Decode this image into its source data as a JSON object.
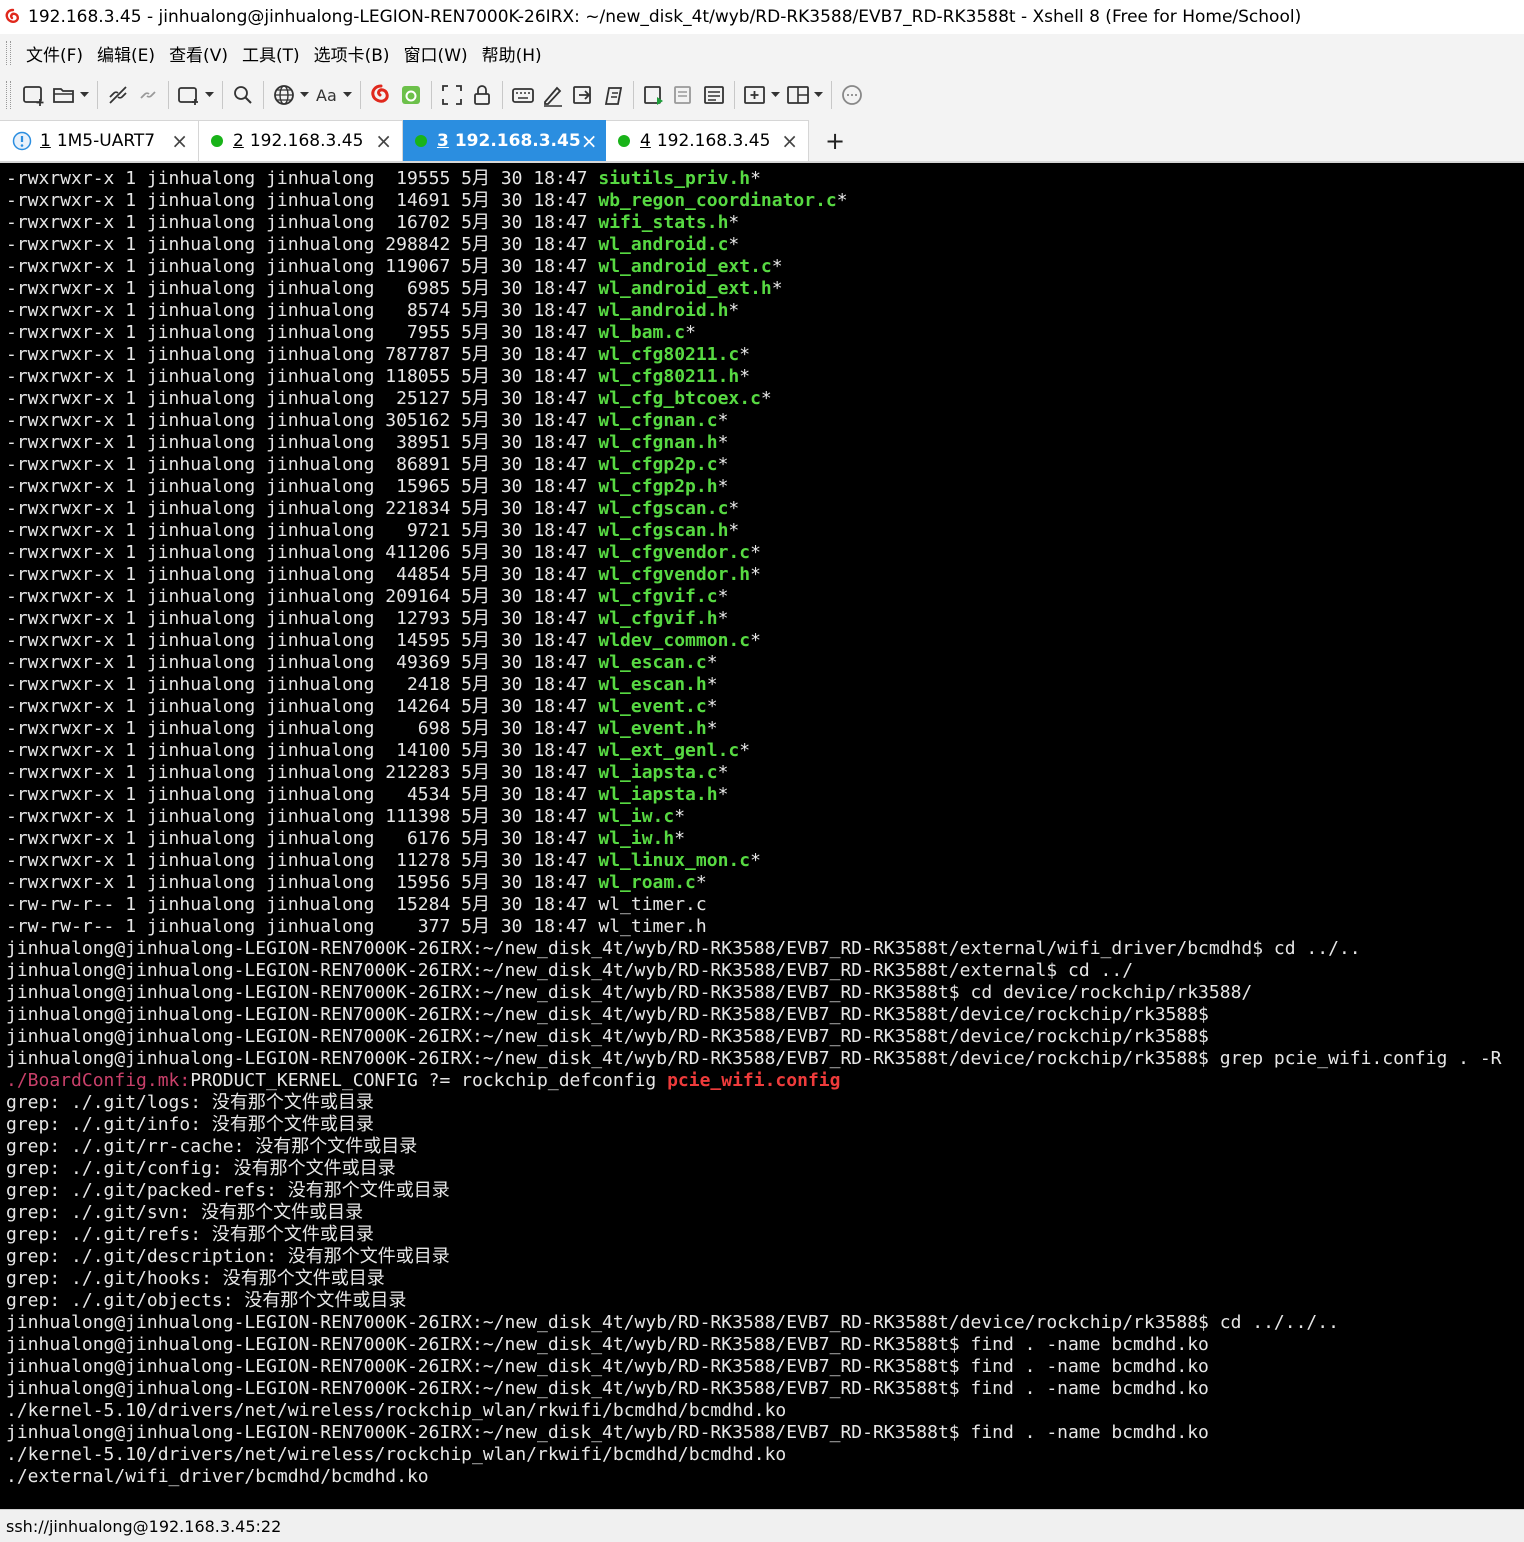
{
  "window": {
    "title": "192.168.3.45 - jinhualong@jinhualong-LEGION-REN7000K-26IRX: ~/new_disk_4t/wyb/RD-RK3588/EVB7_RD-RK3588t - Xshell 8 (Free for Home/School)"
  },
  "colors": {
    "accent": "#2b8ee0",
    "file_green": "#57d942",
    "match_red": "#ee3b3b",
    "path_magenta": "#c9406a",
    "status_green": "#19b319"
  },
  "menu": [
    "文件(F)",
    "编辑(E)",
    "查看(V)",
    "工具(T)",
    "选项卡(B)",
    "窗口(W)",
    "帮助(H)"
  ],
  "toolbar_icons": [
    "new-session-icon",
    "open-folder-icon",
    "disconnect-icon",
    "reconnect-icon",
    "new-window-icon",
    "search-icon",
    "globe-icon",
    "font-icon",
    "xftp-icon",
    "xagent-icon",
    "fullscreen-icon",
    "lock-icon",
    "keyboard-icon",
    "script-icon",
    "transfer-icon",
    "macro-icon",
    "compose-icon",
    "log-icon",
    "list-icon",
    "add-pane-icon",
    "layout-icon",
    "chat-icon"
  ],
  "tabs": [
    {
      "num": "1",
      "label": "1M5-UART7",
      "status": "warning",
      "active": false
    },
    {
      "num": "2",
      "label": "192.168.3.45",
      "status": "connected",
      "active": false
    },
    {
      "num": "3",
      "label": "192.168.3.45",
      "status": "connected",
      "active": true
    },
    {
      "num": "4",
      "label": "192.168.3.45",
      "status": "connected",
      "active": false
    }
  ],
  "new_tab_label": "+",
  "terminal": {
    "files": [
      {
        "perm": "-rwxrwxr-x",
        "size": "19555",
        "name": "siutils_priv.h",
        "exec": true
      },
      {
        "perm": "-rwxrwxr-x",
        "size": "14691",
        "name": "wb_regon_coordinator.c",
        "exec": true
      },
      {
        "perm": "-rwxrwxr-x",
        "size": "16702",
        "name": "wifi_stats.h",
        "exec": true
      },
      {
        "perm": "-rwxrwxr-x",
        "size": "298842",
        "name": "wl_android.c",
        "exec": true
      },
      {
        "perm": "-rwxrwxr-x",
        "size": "119067",
        "name": "wl_android_ext.c",
        "exec": true
      },
      {
        "perm": "-rwxrwxr-x",
        "size": "6985",
        "name": "wl_android_ext.h",
        "exec": true
      },
      {
        "perm": "-rwxrwxr-x",
        "size": "8574",
        "name": "wl_android.h",
        "exec": true
      },
      {
        "perm": "-rwxrwxr-x",
        "size": "7955",
        "name": "wl_bam.c",
        "exec": true
      },
      {
        "perm": "-rwxrwxr-x",
        "size": "787787",
        "name": "wl_cfg80211.c",
        "exec": true
      },
      {
        "perm": "-rwxrwxr-x",
        "size": "118055",
        "name": "wl_cfg80211.h",
        "exec": true
      },
      {
        "perm": "-rwxrwxr-x",
        "size": "25127",
        "name": "wl_cfg_btcoex.c",
        "exec": true
      },
      {
        "perm": "-rwxrwxr-x",
        "size": "305162",
        "name": "wl_cfgnan.c",
        "exec": true
      },
      {
        "perm": "-rwxrwxr-x",
        "size": "38951",
        "name": "wl_cfgnan.h",
        "exec": true
      },
      {
        "perm": "-rwxrwxr-x",
        "size": "86891",
        "name": "wl_cfgp2p.c",
        "exec": true
      },
      {
        "perm": "-rwxrwxr-x",
        "size": "15965",
        "name": "wl_cfgp2p.h",
        "exec": true
      },
      {
        "perm": "-rwxrwxr-x",
        "size": "221834",
        "name": "wl_cfgscan.c",
        "exec": true
      },
      {
        "perm": "-rwxrwxr-x",
        "size": "9721",
        "name": "wl_cfgscan.h",
        "exec": true
      },
      {
        "perm": "-rwxrwxr-x",
        "size": "411206",
        "name": "wl_cfgvendor.c",
        "exec": true
      },
      {
        "perm": "-rwxrwxr-x",
        "size": "44854",
        "name": "wl_cfgvendor.h",
        "exec": true
      },
      {
        "perm": "-rwxrwxr-x",
        "size": "209164",
        "name": "wl_cfgvif.c",
        "exec": true
      },
      {
        "perm": "-rwxrwxr-x",
        "size": "12793",
        "name": "wl_cfgvif.h",
        "exec": true
      },
      {
        "perm": "-rwxrwxr-x",
        "size": "14595",
        "name": "wldev_common.c",
        "exec": true
      },
      {
        "perm": "-rwxrwxr-x",
        "size": "49369",
        "name": "wl_escan.c",
        "exec": true
      },
      {
        "perm": "-rwxrwxr-x",
        "size": "2418",
        "name": "wl_escan.h",
        "exec": true
      },
      {
        "perm": "-rwxrwxr-x",
        "size": "14264",
        "name": "wl_event.c",
        "exec": true
      },
      {
        "perm": "-rwxrwxr-x",
        "size": "698",
        "name": "wl_event.h",
        "exec": true
      },
      {
        "perm": "-rwxrwxr-x",
        "size": "14100",
        "name": "wl_ext_genl.c",
        "exec": true
      },
      {
        "perm": "-rwxrwxr-x",
        "size": "212283",
        "name": "wl_iapsta.c",
        "exec": true
      },
      {
        "perm": "-rwxrwxr-x",
        "size": "4534",
        "name": "wl_iapsta.h",
        "exec": true
      },
      {
        "perm": "-rwxrwxr-x",
        "size": "111398",
        "name": "wl_iw.c",
        "exec": true
      },
      {
        "perm": "-rwxrwxr-x",
        "size": "6176",
        "name": "wl_iw.h",
        "exec": true
      },
      {
        "perm": "-rwxrwxr-x",
        "size": "11278",
        "name": "wl_linux_mon.c",
        "exec": true
      },
      {
        "perm": "-rwxrwxr-x",
        "size": "15956",
        "name": "wl_roam.c",
        "exec": true
      },
      {
        "perm": "-rw-rw-r--",
        "size": "15284",
        "name": "wl_timer.c",
        "exec": false
      },
      {
        "perm": "-rw-rw-r--",
        "size": "377",
        "name": "wl_timer.h",
        "exec": false
      }
    ],
    "ls_links": "1",
    "ls_owner": "jinhualong",
    "ls_group": "jinhualong",
    "ls_date": "5月 30 18:47",
    "exec_suffix": "*",
    "prompt_lines_1": [
      "jinhualong@jinhualong-LEGION-REN7000K-26IRX:~/new_disk_4t/wyb/RD-RK3588/EVB7_RD-RK3588t/external/wifi_driver/bcmdhd$ cd ../..",
      "jinhualong@jinhualong-LEGION-REN7000K-26IRX:~/new_disk_4t/wyb/RD-RK3588/EVB7_RD-RK3588t/external$ cd ../",
      "jinhualong@jinhualong-LEGION-REN7000K-26IRX:~/new_disk_4t/wyb/RD-RK3588/EVB7_RD-RK3588t$ cd device/rockchip/rk3588/",
      "jinhualong@jinhualong-LEGION-REN7000K-26IRX:~/new_disk_4t/wyb/RD-RK3588/EVB7_RD-RK3588t/device/rockchip/rk3588$",
      "jinhualong@jinhualong-LEGION-REN7000K-26IRX:~/new_disk_4t/wyb/RD-RK3588/EVB7_RD-RK3588t/device/rockchip/rk3588$",
      "jinhualong@jinhualong-LEGION-REN7000K-26IRX:~/new_disk_4t/wyb/RD-RK3588/EVB7_RD-RK3588t/device/rockchip/rk3588$ grep pcie_wifi.config . -R"
    ],
    "grep_match": {
      "path": "./BoardConfig.mk",
      "colon": ":",
      "text": "PRODUCT_KERNEL_CONFIG ?= rockchip_defconfig ",
      "match": "pcie_wifi.config"
    },
    "grep_errors": [
      "grep: ./.git/logs: 没有那个文件或目录",
      "grep: ./.git/info: 没有那个文件或目录",
      "grep: ./.git/rr-cache: 没有那个文件或目录",
      "grep: ./.git/config: 没有那个文件或目录",
      "grep: ./.git/packed-refs: 没有那个文件或目录",
      "grep: ./.git/svn: 没有那个文件或目录",
      "grep: ./.git/refs: 没有那个文件或目录",
      "grep: ./.git/description: 没有那个文件或目录",
      "grep: ./.git/hooks: 没有那个文件或目录",
      "grep: ./.git/objects: 没有那个文件或目录"
    ],
    "prompt_lines_2": [
      "jinhualong@jinhualong-LEGION-REN7000K-26IRX:~/new_disk_4t/wyb/RD-RK3588/EVB7_RD-RK3588t/device/rockchip/rk3588$ cd ../../..",
      "jinhualong@jinhualong-LEGION-REN7000K-26IRX:~/new_disk_4t/wyb/RD-RK3588/EVB7_RD-RK3588t$ find . -name bcmdhd.ko",
      "jinhualong@jinhualong-LEGION-REN7000K-26IRX:~/new_disk_4t/wyb/RD-RK3588/EVB7_RD-RK3588t$ find . -name bcmdhd.ko",
      "jinhualong@jinhualong-LEGION-REN7000K-26IRX:~/new_disk_4t/wyb/RD-RK3588/EVB7_RD-RK3588t$ find . -name bcmdhd.ko",
      "./kernel-5.10/drivers/net/wireless/rockchip_wlan/rkwifi/bcmdhd/bcmdhd.ko",
      "jinhualong@jinhualong-LEGION-REN7000K-26IRX:~/new_disk_4t/wyb/RD-RK3588/EVB7_RD-RK3588t$ find . -name bcmdhd.ko",
      "./kernel-5.10/drivers/net/wireless/rockchip_wlan/rkwifi/bcmdhd/bcmdhd.ko",
      "./external/wifi_driver/bcmdhd/bcmdhd.ko"
    ]
  },
  "statusbar": {
    "connection": "ssh://jinhualong@192.168.3.45:22"
  }
}
